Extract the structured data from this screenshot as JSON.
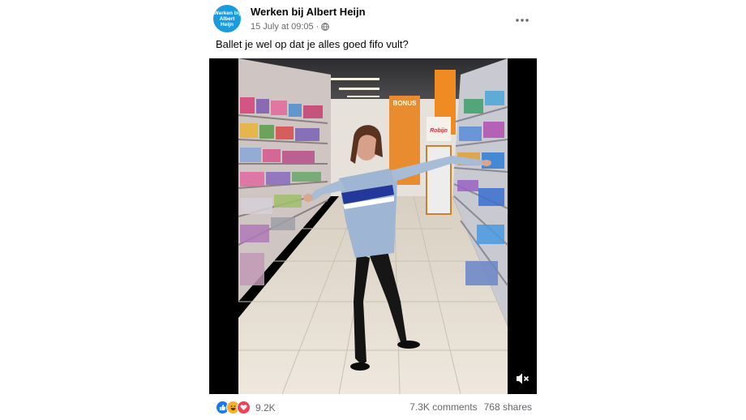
{
  "post": {
    "page_name": "Werken bij Albert Heijn",
    "avatar_text_line1": "Werken bij",
    "avatar_text_line2": "Albert Heijn",
    "timestamp": "15 July at 09:05",
    "visibility_icon": "globe-icon",
    "more_icon": "more-options-icon",
    "caption": "Ballet je wel op dat je alles goed fifo vult?"
  },
  "video": {
    "signs": {
      "bonus": "BONUS",
      "brand": "Robijn"
    },
    "mute_icon": "speaker-muted-icon"
  },
  "footer": {
    "reaction_icons": [
      "like-icon",
      "haha-icon",
      "love-icon"
    ],
    "reaction_count": "9.2K",
    "comments": "7.3K comments",
    "shares": "768 shares"
  },
  "colors": {
    "avatar_bg": "#1a9be0",
    "like": "#1877f2",
    "haha": "#f7b125",
    "love": "#f33e58",
    "secondary_text": "#65676b"
  }
}
